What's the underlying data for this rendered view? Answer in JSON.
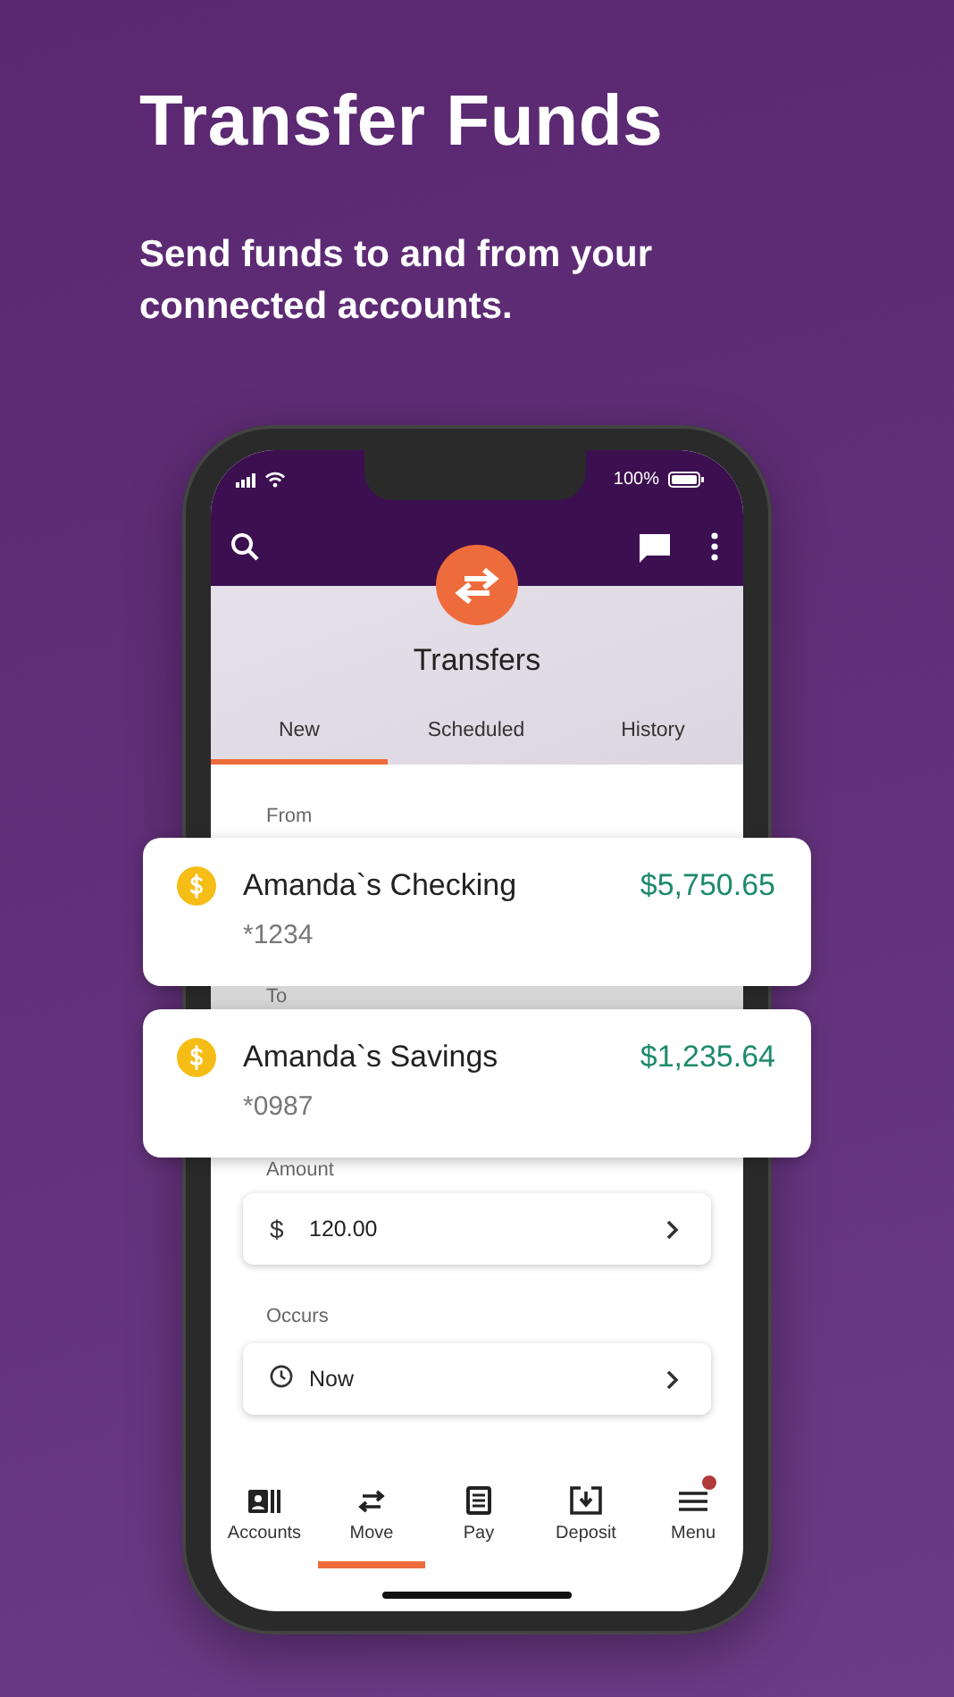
{
  "headline": "Transfer Funds",
  "subheadline": "Send funds to and from your connected accounts.",
  "status_bar": {
    "battery": "100%"
  },
  "screen_title": "Transfers",
  "tabs": [
    {
      "label": "New",
      "selected": true
    },
    {
      "label": "Scheduled",
      "selected": false
    },
    {
      "label": "History",
      "selected": false
    }
  ],
  "from": {
    "label": "From",
    "account": {
      "name": "Amanda`s Checking",
      "number": "*1234",
      "balance": "$5,750.65"
    }
  },
  "to": {
    "label": "To",
    "account": {
      "name": "Amanda`s Savings",
      "number": "*0987",
      "balance": "$1,235.64"
    }
  },
  "amount": {
    "label": "Amount",
    "currency": "$",
    "value": "120.00"
  },
  "occurs": {
    "label": "Occurs",
    "value": "Now"
  },
  "nav": [
    {
      "kind": "accounts",
      "label": "Accounts",
      "selected": false,
      "badge": false
    },
    {
      "kind": "move",
      "label": "Move",
      "selected": true,
      "badge": false
    },
    {
      "kind": "pay",
      "label": "Pay",
      "selected": false,
      "badge": false
    },
    {
      "kind": "deposit",
      "label": "Deposit",
      "selected": false,
      "badge": false
    },
    {
      "kind": "menu",
      "label": "Menu",
      "selected": false,
      "badge": true
    }
  ]
}
